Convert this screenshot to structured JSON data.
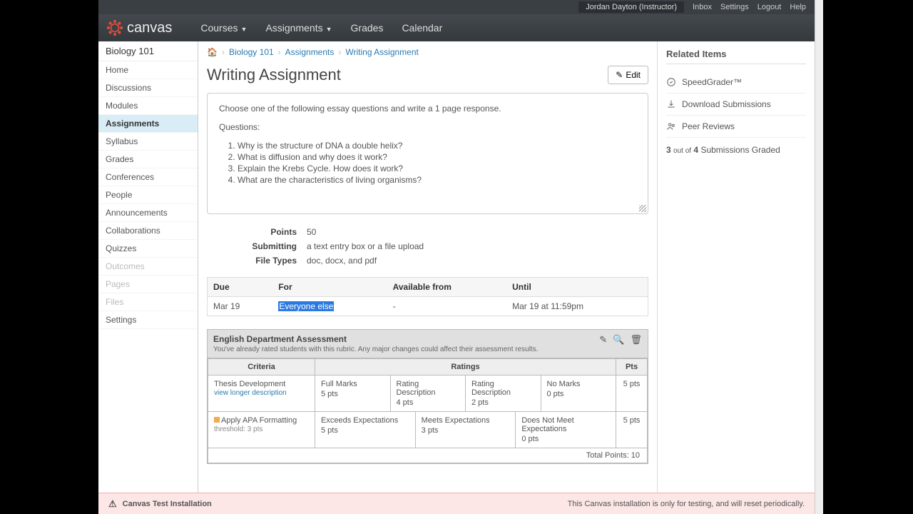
{
  "userbar": {
    "user": "Jordan Dayton (Instructor)",
    "links": [
      "Inbox",
      "Settings",
      "Logout",
      "Help"
    ]
  },
  "brand": "canvas",
  "nav": {
    "items": [
      {
        "label": "Courses",
        "dropdown": true
      },
      {
        "label": "Assignments",
        "dropdown": true
      },
      {
        "label": "Grades",
        "dropdown": false
      },
      {
        "label": "Calendar",
        "dropdown": false
      }
    ]
  },
  "course": "Biology 101",
  "sidebar": [
    {
      "label": "Home"
    },
    {
      "label": "Discussions"
    },
    {
      "label": "Modules"
    },
    {
      "label": "Assignments",
      "active": true
    },
    {
      "label": "Syllabus"
    },
    {
      "label": "Grades"
    },
    {
      "label": "Conferences"
    },
    {
      "label": "People"
    },
    {
      "label": "Announcements"
    },
    {
      "label": "Collaborations"
    },
    {
      "label": "Quizzes"
    },
    {
      "label": "Outcomes",
      "muted": true
    },
    {
      "label": "Pages",
      "muted": true
    },
    {
      "label": "Files",
      "muted": true
    },
    {
      "label": "Settings"
    }
  ],
  "crumbs": {
    "home": "⌂",
    "c1": "Biology 101",
    "c2": "Assignments",
    "c3": "Writing Assignment"
  },
  "assignment": {
    "title": "Writing Assignment",
    "edit": "Edit",
    "desc_intro": "Choose one of the following essay questions and write a 1 page response.",
    "desc_qlabel": "Questions:",
    "questions": [
      "Why is the structure of DNA a double helix?",
      "What is diffusion and why does it work?",
      "Explain the Krebs Cycle. How does it work?",
      "What are the characteristics of living organisms?"
    ],
    "meta": {
      "points_label": "Points",
      "points": "50",
      "submitting_label": "Submitting",
      "submitting": "a text entry box or a file upload",
      "filetypes_label": "File Types",
      "filetypes": "doc, docx, and pdf"
    },
    "due": {
      "headers": {
        "due": "Due",
        "for": "For",
        "avail": "Available from",
        "until": "Until"
      },
      "row": {
        "due": "Mar 19",
        "for": "Everyone else",
        "avail": "-",
        "until": "Mar 19 at 11:59pm"
      }
    }
  },
  "rubric": {
    "title": "English Department Assessment",
    "note": "You've already rated students with this rubric. Any major changes could affect their assessment results.",
    "headers": {
      "criteria": "Criteria",
      "ratings": "Ratings",
      "pts": "Pts"
    },
    "rows": [
      {
        "criterion": "Thesis Development",
        "viewlong": "view longer description",
        "ratings": [
          {
            "label": "Full Marks",
            "pts": "5 pts"
          },
          {
            "label": "Rating Description",
            "pts": "4 pts"
          },
          {
            "label": "Rating Description",
            "pts": "2 pts"
          },
          {
            "label": "No Marks",
            "pts": "0 pts"
          }
        ],
        "pts": "5 pts"
      },
      {
        "criterion": "Apply APA Formatting",
        "threshold": "threshold: 3 pts",
        "outcome": true,
        "ratings": [
          {
            "label": "Exceeds Expectations",
            "pts": "5 pts"
          },
          {
            "label": "Meets Expectations",
            "pts": "3 pts"
          },
          {
            "label": "Does Not Meet Expectations",
            "pts": "0 pts"
          }
        ],
        "pts": "5 pts"
      }
    ],
    "total_label": "Total Points:",
    "total": "10"
  },
  "related": {
    "title": "Related Items",
    "items": [
      {
        "icon": "speedgrader",
        "label": "SpeedGrader™"
      },
      {
        "icon": "download",
        "label": "Download Submissions"
      },
      {
        "icon": "peer",
        "label": "Peer Reviews"
      }
    ],
    "graded": {
      "n": "3",
      "of_word": "out of",
      "total": "4",
      "label": "Submissions Graded"
    }
  },
  "footer": {
    "left": "Canvas Test Installation",
    "right": "This Canvas installation is only for testing, and will reset periodically."
  }
}
